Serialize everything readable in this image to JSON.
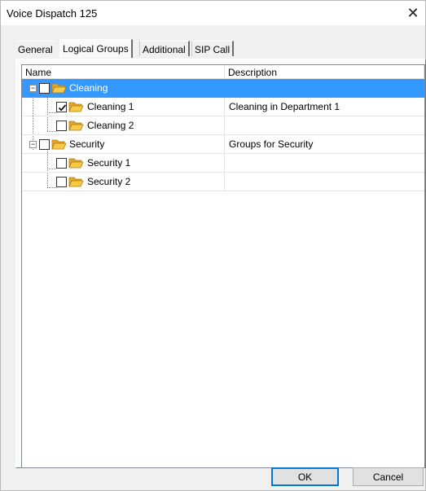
{
  "window": {
    "title": "Voice Dispatch 125"
  },
  "tabs": [
    {
      "label": "General"
    },
    {
      "label": "Logical Groups"
    },
    {
      "label": "Additional"
    },
    {
      "label": "SIP Call"
    }
  ],
  "active_tab": "Logical Groups",
  "columns": {
    "name": "Name",
    "description": "Description"
  },
  "rows": [
    {
      "name": "Cleaning",
      "description": "",
      "level": 0,
      "expanded": true,
      "checked": false,
      "selected": true
    },
    {
      "name": "Cleaning 1",
      "description": "Cleaning in Department 1",
      "level": 1,
      "checked": true,
      "selected": false
    },
    {
      "name": "Cleaning 2",
      "description": "",
      "level": 1,
      "checked": false,
      "selected": false
    },
    {
      "name": "Security",
      "description": "Groups for Security",
      "level": 0,
      "expanded": true,
      "checked": false,
      "selected": false
    },
    {
      "name": "Security 1",
      "description": "",
      "level": 1,
      "checked": false,
      "selected": false
    },
    {
      "name": "Security 2",
      "description": "",
      "level": 1,
      "checked": false,
      "selected": false
    }
  ],
  "buttons": {
    "ok": "OK",
    "cancel": "Cancel"
  },
  "icons": {
    "close": "close-icon",
    "folder": "open-folder-icon",
    "expand": "minus-expander-icon",
    "check": "checkmark-icon"
  },
  "colors": {
    "selection": "#3399ff",
    "folder": "#f7c948"
  }
}
